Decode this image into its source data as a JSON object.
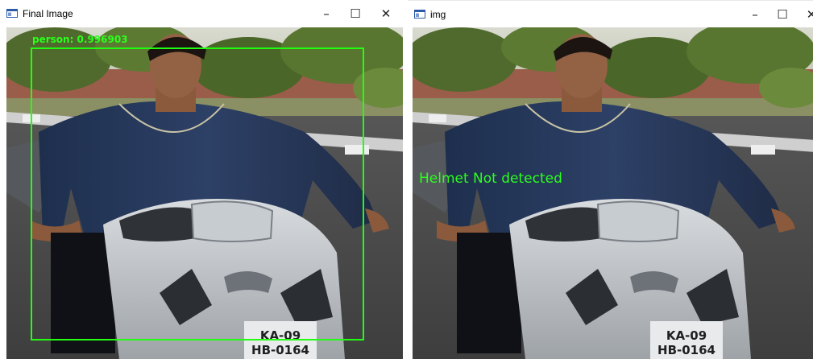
{
  "windows": [
    {
      "title": "Final Image",
      "controls": {
        "minimize": "–",
        "maximize": "☐",
        "close": "✕"
      },
      "detection": {
        "label": "person: 0.996903",
        "color": "#20ff10"
      }
    },
    {
      "title": "img",
      "controls": {
        "minimize": "–",
        "maximize": "☐",
        "close": "✕"
      },
      "overlay": {
        "text": "Helmet Not detected",
        "color": "#2bff1c"
      }
    }
  ],
  "icons": {
    "app": "window-app-icon",
    "minimize": "minimize-icon",
    "maximize": "maximize-icon",
    "close": "close-icon"
  },
  "plate": {
    "line1": "KA-09",
    "line2": "HB-0164"
  }
}
